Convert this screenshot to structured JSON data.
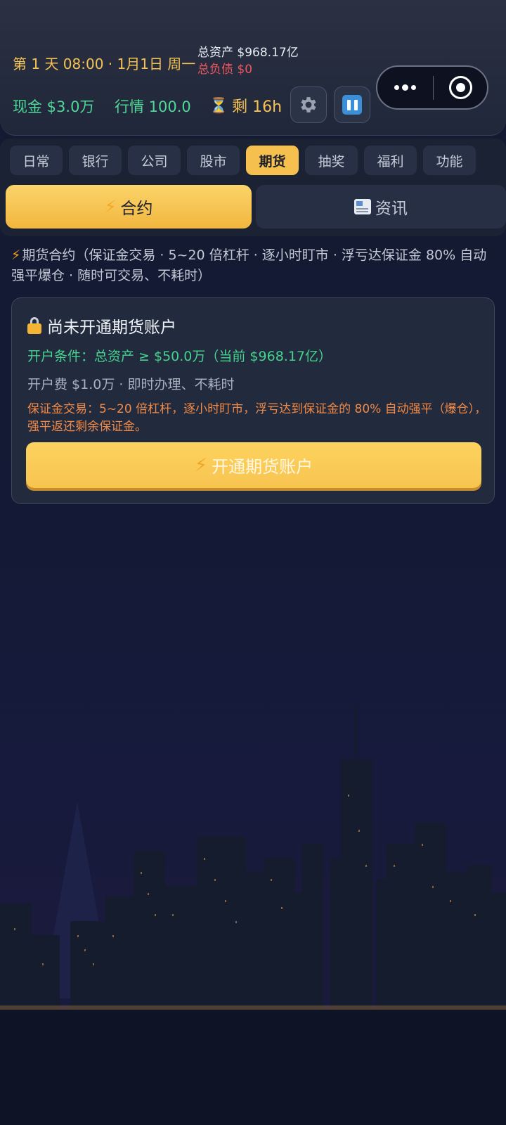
{
  "header": {
    "day_text": "第 1 天 08:00 · 1月1日 周一",
    "total_assets": "总资产 $968.17亿",
    "total_debt": "总负债 $0",
    "cash": "现金 $3.0万",
    "market": "行情 100.0",
    "remaining": "剩 16h",
    "icons": [
      "hourglass-icon",
      "gear-icon",
      "pause-icon",
      "more-dots-icon",
      "record-icon"
    ]
  },
  "tabs": [
    {
      "label": "日常",
      "active": false
    },
    {
      "label": "银行",
      "active": false
    },
    {
      "label": "公司",
      "active": false
    },
    {
      "label": "股市",
      "active": false
    },
    {
      "label": "期货",
      "active": true
    },
    {
      "label": "抽奖",
      "active": false
    },
    {
      "label": "福利",
      "active": false
    },
    {
      "label": "功能",
      "active": false
    }
  ],
  "sub_tabs": {
    "contract": "合约",
    "news": "资讯"
  },
  "description": "期货合约（保证金交易 · 5~20 倍杠杆 · 逐小时盯市 · 浮亏达保证金 80% 自动强平爆仓 · 随时可交易、不耗时）",
  "card": {
    "title": "尚未开通期货账户",
    "condition": "开户条件：总资产 ≥ $50.0万（当前 $968.17亿）",
    "fee": "开户费 $1.0万 · 即时办理、不耗时",
    "margin_note": "保证金交易：5~20 倍杠杆，逐小时盯市，浮亏达到保证金的 80% 自动强平（爆仓），强平返还剩余保证金。",
    "open_button": "开通期货账户"
  },
  "colors": {
    "accent_gold": "#f5c04d",
    "positive_green": "#4fd897",
    "debt_red": "#ef5560",
    "warning_orange": "#f28a45"
  }
}
